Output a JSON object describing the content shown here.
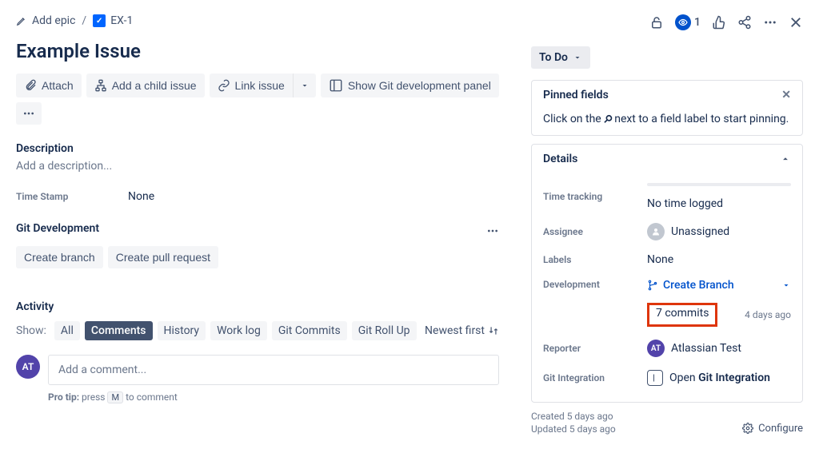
{
  "breadcrumb": {
    "add_epic": "Add epic",
    "issue_key": "EX-1"
  },
  "header_actions": {
    "watch_count": "1"
  },
  "issue": {
    "title": "Example Issue"
  },
  "toolbar": {
    "attach": "Attach",
    "add_child": "Add a child issue",
    "link_issue": "Link issue",
    "git_panel": "Show Git development panel"
  },
  "description": {
    "label": "Description",
    "placeholder": "Add a description..."
  },
  "fields": {
    "time_stamp": {
      "label": "Time Stamp",
      "value": "None"
    }
  },
  "git_dev": {
    "label": "Git Development",
    "create_branch": "Create branch",
    "create_pr": "Create pull request"
  },
  "activity": {
    "label": "Activity",
    "show": "Show:",
    "tabs": {
      "all": "All",
      "comments": "Comments",
      "history": "History",
      "work_log": "Work log",
      "git_commits": "Git Commits",
      "git_rollup": "Git Roll Up"
    },
    "sort": "Newest first",
    "comment_placeholder": "Add a comment...",
    "avatar_initials": "AT",
    "protip_prefix": "Pro tip:",
    "protip_a": " press ",
    "protip_key": "M",
    "protip_b": " to comment"
  },
  "status": {
    "value": "To Do"
  },
  "pinned": {
    "title": "Pinned fields",
    "hint_a": "Click on the ",
    "hint_b": " next to a field label to start pinning."
  },
  "details": {
    "title": "Details",
    "time_tracking": {
      "label": "Time tracking",
      "value": "No time logged"
    },
    "assignee": {
      "label": "Assignee",
      "value": "Unassigned"
    },
    "labels": {
      "label": "Labels",
      "value": "None"
    },
    "development": {
      "label": "Development",
      "create_branch": "Create Branch",
      "commits": "7 commits",
      "commits_age": "4 days ago"
    },
    "reporter": {
      "label": "Reporter",
      "value": "Atlassian Test",
      "initials": "AT"
    },
    "git_integration": {
      "label": "Git Integration",
      "prefix": "Open ",
      "bold": "Git Integration"
    }
  },
  "meta": {
    "created": "Created 5 days ago",
    "updated": "Updated 5 days ago",
    "configure": "Configure"
  }
}
